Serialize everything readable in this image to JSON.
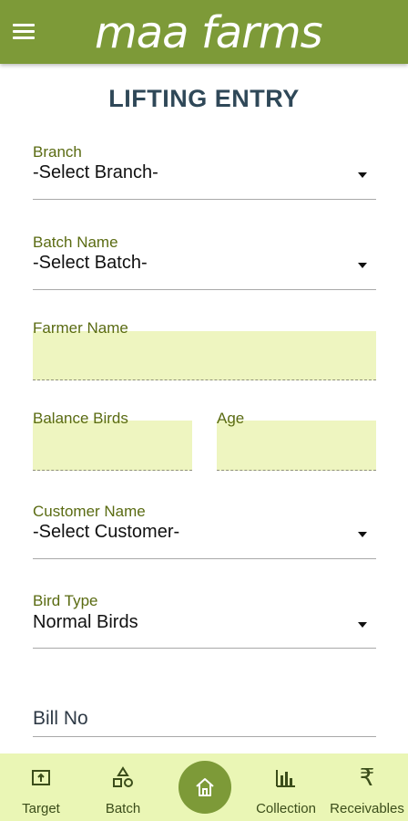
{
  "app": {
    "brand": "maa farms"
  },
  "page": {
    "title": "LIFTING ENTRY"
  },
  "form": {
    "branch": {
      "label": "Branch",
      "value": "-Select Branch-"
    },
    "batch": {
      "label": "Batch Name",
      "value": "-Select Batch-"
    },
    "farmer_name": {
      "label": "Farmer Name",
      "value": ""
    },
    "balance_birds": {
      "label": "Balance Birds",
      "value": ""
    },
    "age": {
      "label": "Age",
      "value": ""
    },
    "customer": {
      "label": "Customer Name",
      "value": "-Select Customer-"
    },
    "bird_type": {
      "label": "Bird Type",
      "value": "Normal Birds"
    },
    "bill_no": {
      "placeholder": "Bill No"
    }
  },
  "bottom_nav": {
    "items": [
      {
        "label": "Target",
        "icon": "target-icon"
      },
      {
        "label": "Batch",
        "icon": "shapes-icon"
      },
      {
        "label": "",
        "icon": "home-icon"
      },
      {
        "label": "Collection",
        "icon": "bar-chart-icon"
      },
      {
        "label": "Receivables",
        "icon": "rupee-icon"
      }
    ]
  },
  "colors": {
    "brand_green": "#7d9a38",
    "input_fill": "#eef5c0",
    "nav_background": "#eaf6b5",
    "title_color": "#2f4858",
    "label_color": "#5a6b12"
  }
}
